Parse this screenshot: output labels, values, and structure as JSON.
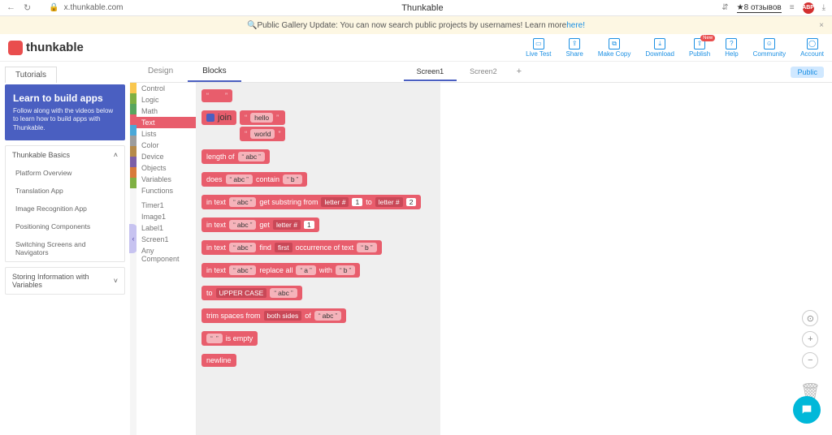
{
  "browser": {
    "url": "x.thunkable.com",
    "title": "Thunkable",
    "reviews": "★8 отзывов"
  },
  "banner": {
    "icon": "🔍",
    "text": "Public Gallery Update: You can now search public projects by usernames! Learn more ",
    "link": "here!"
  },
  "logo": "thunkable",
  "headerActions": {
    "liveTest": "Live Test",
    "share": "Share",
    "makeCopy": "Make Copy",
    "download": "Download",
    "publish": "Publish",
    "publishBadge": "New",
    "help": "Help",
    "community": "Community",
    "account": "Account"
  },
  "sidebar": {
    "tutorialsTab": "Tutorials",
    "learn": {
      "title": "Learn to build apps",
      "desc": "Follow along with the videos below to learn how to build apps with Thunkable."
    },
    "basics": {
      "head": "Thunkable Basics",
      "items": [
        "Platform Overview",
        "Translation App",
        "Image Recognition App",
        "Positioning Components",
        "Switching Screens and Navigators"
      ]
    },
    "storing": {
      "head": "Storing Information with Variables"
    }
  },
  "modeTabs": {
    "design": "Design",
    "blocks": "Blocks"
  },
  "screenTabs": {
    "s1": "Screen1",
    "s2": "Screen2"
  },
  "publicChip": "Public",
  "categories": {
    "list": [
      "Control",
      "Logic",
      "Math",
      "Text",
      "Lists",
      "Color",
      "Device",
      "Objects",
      "Variables",
      "Functions"
    ],
    "components": [
      "Timer1",
      "Image1",
      "Label1",
      "Screen1",
      "Any Component"
    ],
    "colors": [
      "#f9c74f",
      "#7fb043",
      "#58a55e",
      "#e85d6c",
      "#4aa8d8",
      "#9c9c9c",
      "#b58a4a",
      "#7b5ea7",
      "#d87a3a",
      "#7fb043"
    ],
    "selected": 3
  },
  "blocks": {
    "empty": {
      "q1": "“",
      "q2": "”",
      "val": ""
    },
    "join": {
      "label": "join",
      "a": "hello",
      "b": "world"
    },
    "length": {
      "label": "length of",
      "arg": "abc"
    },
    "does": {
      "l1": "does",
      "arg": "abc",
      "l2": "contain",
      "arg2": "b"
    },
    "substr": {
      "l1": "in text",
      "arg": "abc",
      "l2": "get substring from",
      "d1": "letter #",
      "n1": "1",
      "l3": "to",
      "d2": "letter #",
      "n2": "2"
    },
    "letter": {
      "l1": "in text",
      "arg": "abc",
      "l2": "get",
      "d": "letter #",
      "n": "1"
    },
    "find": {
      "l1": "in text",
      "arg": "abc",
      "l2": "find",
      "d": "first",
      "l3": "occurrence of text",
      "arg2": "b"
    },
    "replace": {
      "l1": "in text",
      "arg": "abc",
      "l2": "replace all",
      "arg2": "a",
      "l3": "with",
      "arg3": "b"
    },
    "upper": {
      "l1": "to",
      "d": "UPPER CASE",
      "arg": "abc"
    },
    "trim": {
      "l1": "trim spaces from",
      "d": "both sides",
      "l2": "of",
      "arg": "abc"
    },
    "isempty": {
      "arg": "",
      "l": "is empty"
    },
    "newline": {
      "l": "newline"
    }
  }
}
